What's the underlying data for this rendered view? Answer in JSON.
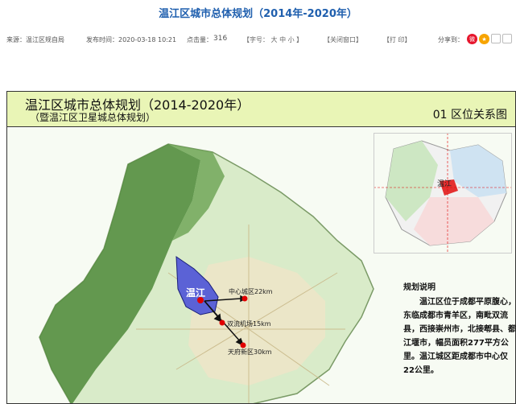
{
  "page": {
    "title": "温江区城市总体规划（2014年-2020年）"
  },
  "meta": {
    "source": "来源：温江区规自局",
    "publish_time": "发布时间：2020-03-18 10:21",
    "hits_label": "点击量：",
    "hits_value": "316",
    "font_size": "【字号： 大 中 小 】",
    "close_window": "【关闭窗口】",
    "print": "【打 印】",
    "share": "分享到："
  },
  "poster": {
    "title": "温江区城市总体规划（2014-2020年）",
    "subtitle": "（暨温江区卫星城总体规划）",
    "section": "01 区位关系图",
    "district": "温江",
    "inset_label": "温江",
    "labels": {
      "center": "中心城区22km",
      "airport": "双流机场15km",
      "tianfu": "天府新区30km"
    },
    "description": {
      "heading": "规划说明",
      "body": "温江区位于成都平原腹心，东临成都市青羊区，南毗双流县，西接崇州市，北接郫县、都江堰市，幅员面积277平方公里。温江城区距成都市中心仅22公里。"
    }
  },
  "colors": {
    "title_blue": "#1f5fae",
    "poster_header": "#e9f5b6",
    "district_fill": "#5b62d6",
    "marker_red": "#e10000",
    "weibo": "#e6162d",
    "qzone": "#f7a400"
  }
}
